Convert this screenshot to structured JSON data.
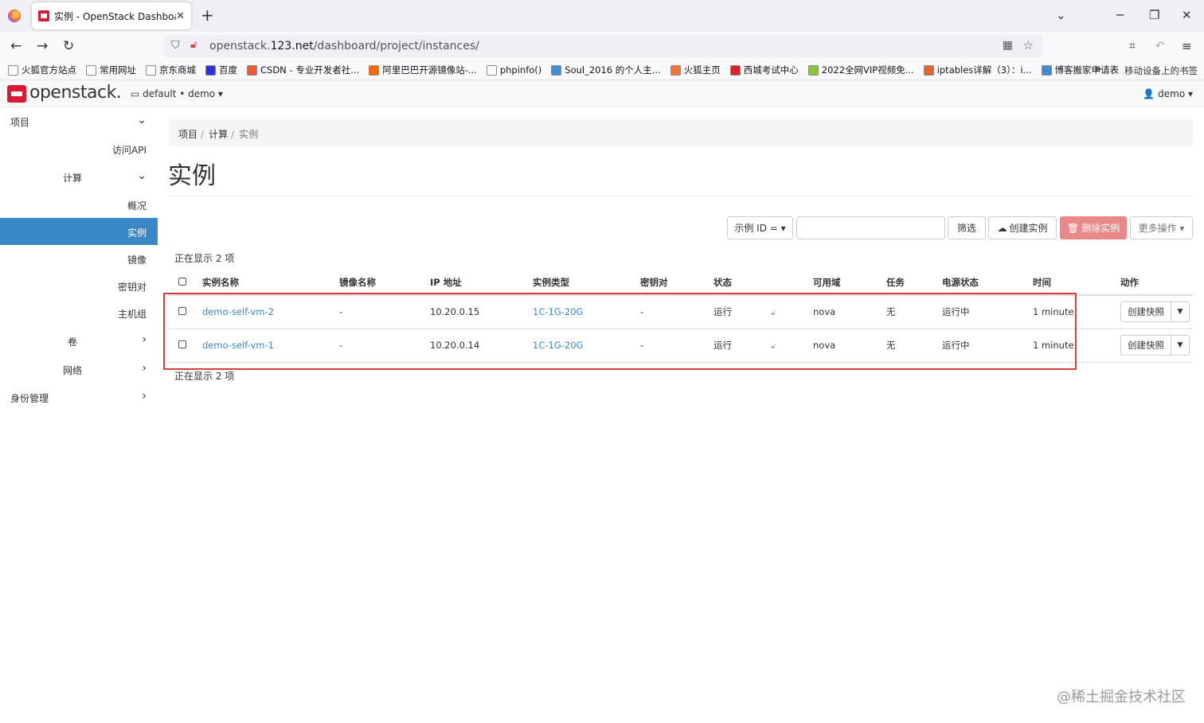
{
  "browser": {
    "tab_title": "实例 - OpenStack Dashboard",
    "tab_close": "✕",
    "new_tab": "+",
    "url_prefix": "openstack.",
    "url_host": "123.net",
    "url_path": "/dashboard/project/instances/",
    "bookmarks": [
      {
        "label": "火狐官方站点",
        "color": "#ffffff"
      },
      {
        "label": "常用网址",
        "color": "#ffffff"
      },
      {
        "label": "京东商城",
        "color": "#ffffff"
      },
      {
        "label": "百度",
        "color": "#2932e1"
      },
      {
        "label": "CSDN - 专业开发者社...",
        "color": "#fc5531"
      },
      {
        "label": "阿里巴巴开源镜像站-...",
        "color": "#ff6a00"
      },
      {
        "label": "phpinfo()",
        "color": "#ffffff"
      },
      {
        "label": "Soul_2016 的个人主...",
        "color": "#3e8ede"
      },
      {
        "label": "火狐主页",
        "color": "#ff7139"
      },
      {
        "label": "西城考试中心",
        "color": "#d7262b"
      },
      {
        "label": "2022全网VIP视频免...",
        "color": "#8ac33d"
      },
      {
        "label": "iptables详解（3）：i...",
        "color": "#e8642c"
      },
      {
        "label": "博客搬家申请表",
        "color": "#3b8fd9"
      }
    ],
    "bookmarks_more": "»",
    "mobile_bookmarks": "移动设备上的书签"
  },
  "header": {
    "logo_text": "openstack.",
    "project_selector": "default • demo ▾",
    "user_menu": "👤 demo ▾"
  },
  "sidebar": {
    "project": "项目",
    "access_api": "访问API",
    "compute": "计算",
    "overview": "概况",
    "instances": "实例",
    "images": "镜像",
    "keypairs": "密钥对",
    "server_groups": "主机组",
    "volumes": "卷",
    "network": "网络",
    "identity": "身份管理"
  },
  "breadcrumb": {
    "project": "项目",
    "compute": "计算",
    "current": "实例",
    "sep": "/"
  },
  "page_title": "实例",
  "toolbar": {
    "filter_field": "示例 ID = ▾",
    "filter_button": "筛选",
    "create_button": "创建实例",
    "delete_button": "删除实例",
    "more_button": "更多操作 ▾"
  },
  "count_text": "正在显示 2 项",
  "table": {
    "columns": [
      "实例名称",
      "镜像名称",
      "IP 地址",
      "实例类型",
      "密钥对",
      "状态",
      "",
      "可用域",
      "任务",
      "电源状态",
      "时间",
      "动作"
    ],
    "rows": [
      {
        "name": "demo-self-vm-2",
        "image": "-",
        "ip": "10.20.0.15",
        "flavor": "1C-1G-20G",
        "keypair": "-",
        "status": "运行",
        "az": "nova",
        "task": "无",
        "power": "运行中",
        "age": "1 minute",
        "action": "创建快照"
      },
      {
        "name": "demo-self-vm-1",
        "image": "-",
        "ip": "10.20.0.14",
        "flavor": "1C-1G-20G",
        "keypair": "-",
        "status": "运行",
        "az": "nova",
        "task": "无",
        "power": "运行中",
        "age": "1 minute",
        "action": "创建快照"
      }
    ]
  },
  "watermark": "@稀土掘金技术社区"
}
